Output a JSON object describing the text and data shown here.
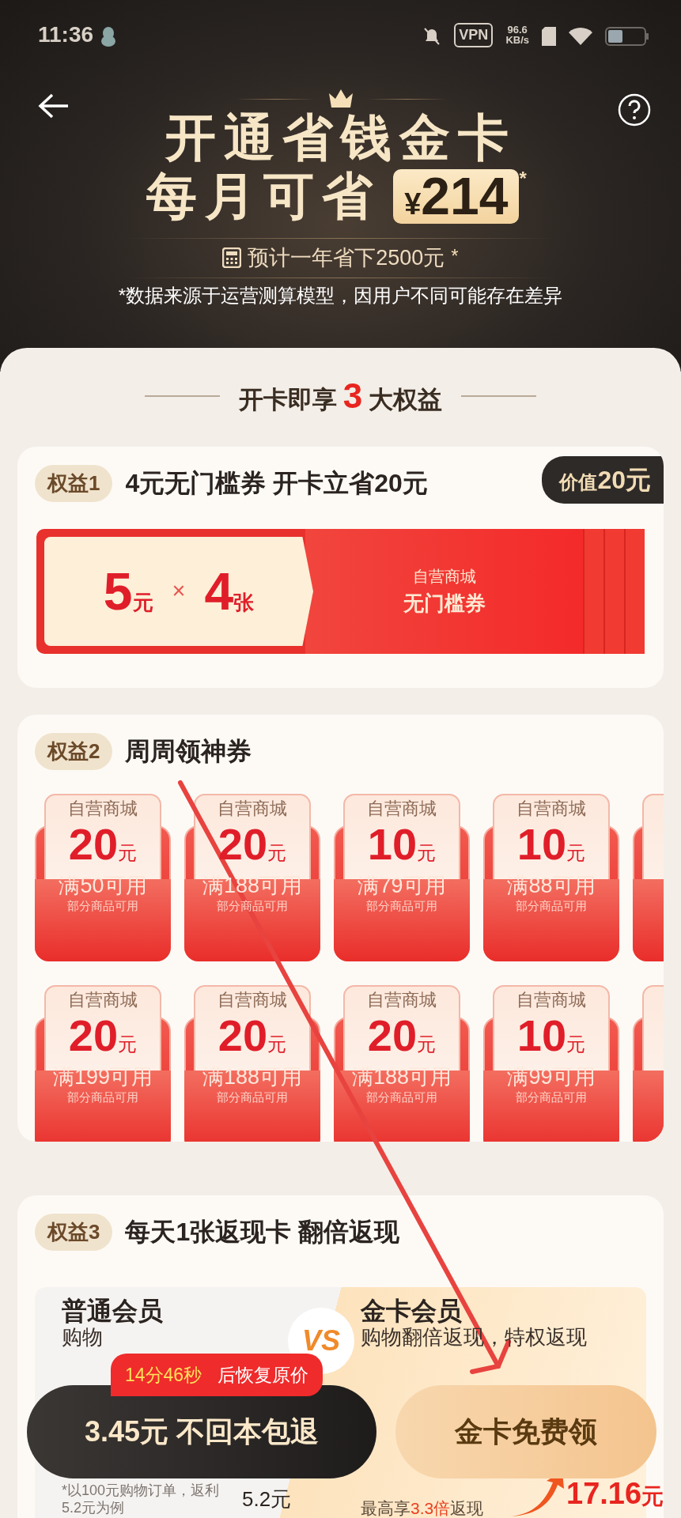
{
  "status_bar": {
    "time": "11:36",
    "vpn": "VPN",
    "speed_value": "96.6",
    "speed_unit": "KB/s"
  },
  "header": {
    "title": "开通省钱金卡",
    "monthly_label": "每月可省",
    "monthly_currency": "¥",
    "monthly_amount": "214",
    "monthly_mark": "*",
    "yearly": "预计一年省下2500元",
    "yearly_mark": "*",
    "disclaimer": "*数据来源于运营测算模型，因用户不同可能存在差异"
  },
  "section_heading": {
    "prefix": "开卡即享",
    "number": "3",
    "suffix": "大权益"
  },
  "benefits": [
    {
      "kind": "voucher",
      "tag": "权益1",
      "title": "4元无门槛券 开卡立省20元",
      "value_label": "价值",
      "value_amount": "20元",
      "voucher": {
        "amount": "5",
        "unit": "元",
        "times": "×",
        "count": "4",
        "count_unit": "张",
        "store": "自营商城",
        "type": "无门槛券"
      }
    },
    {
      "kind": "coupons",
      "tag": "权益2",
      "title": "周周领神券",
      "coupons": [
        {
          "store": "自营商城",
          "amount": "20",
          "unit": "元",
          "condition": "满50可用",
          "note": "部分商品可用"
        },
        {
          "store": "自营商城",
          "amount": "20",
          "unit": "元",
          "condition": "满188可用",
          "note": "部分商品可用"
        },
        {
          "store": "自营商城",
          "amount": "10",
          "unit": "元",
          "condition": "满79可用",
          "note": "部分商品可用"
        },
        {
          "store": "自营商城",
          "amount": "10",
          "unit": "元",
          "condition": "满88可用",
          "note": "部分商品可用"
        },
        {
          "store": "自营商城",
          "amount": "20",
          "unit": "元",
          "condition": "满199可用",
          "note": "部分商品可用"
        },
        {
          "store": "自营商城",
          "amount": "20",
          "unit": "元",
          "condition": "满188可用",
          "note": "部分商品可用"
        },
        {
          "store": "自营商城",
          "amount": "20",
          "unit": "元",
          "condition": "满188可用",
          "note": "部分商品可用"
        },
        {
          "store": "自营商城",
          "amount": "10",
          "unit": "元",
          "condition": "满99可用",
          "note": "部分商品可用"
        }
      ]
    },
    {
      "kind": "compare",
      "tag": "权益3",
      "title": "每天1张返现卡 翻倍返现",
      "vs": "VS",
      "left": {
        "title": "普通会员",
        "subtitle": "购物",
        "note": "*以100元购物订单，返利5.2元为例",
        "amount": "5.2元"
      },
      "right": {
        "title": "金卡会员",
        "subtitle": "购物翻倍返现，特权返现",
        "max_prefix": "最高享",
        "max_highlight": "3.3倍",
        "max_suffix": "返现",
        "amount": "17.16",
        "amount_unit": "元"
      }
    }
  ],
  "bottom_bar": {
    "timer_value": "14分46秒",
    "timer_suffix": "后恢复原价",
    "left_button": "3.45元 不回本包退",
    "right_button": "金卡免费领"
  }
}
